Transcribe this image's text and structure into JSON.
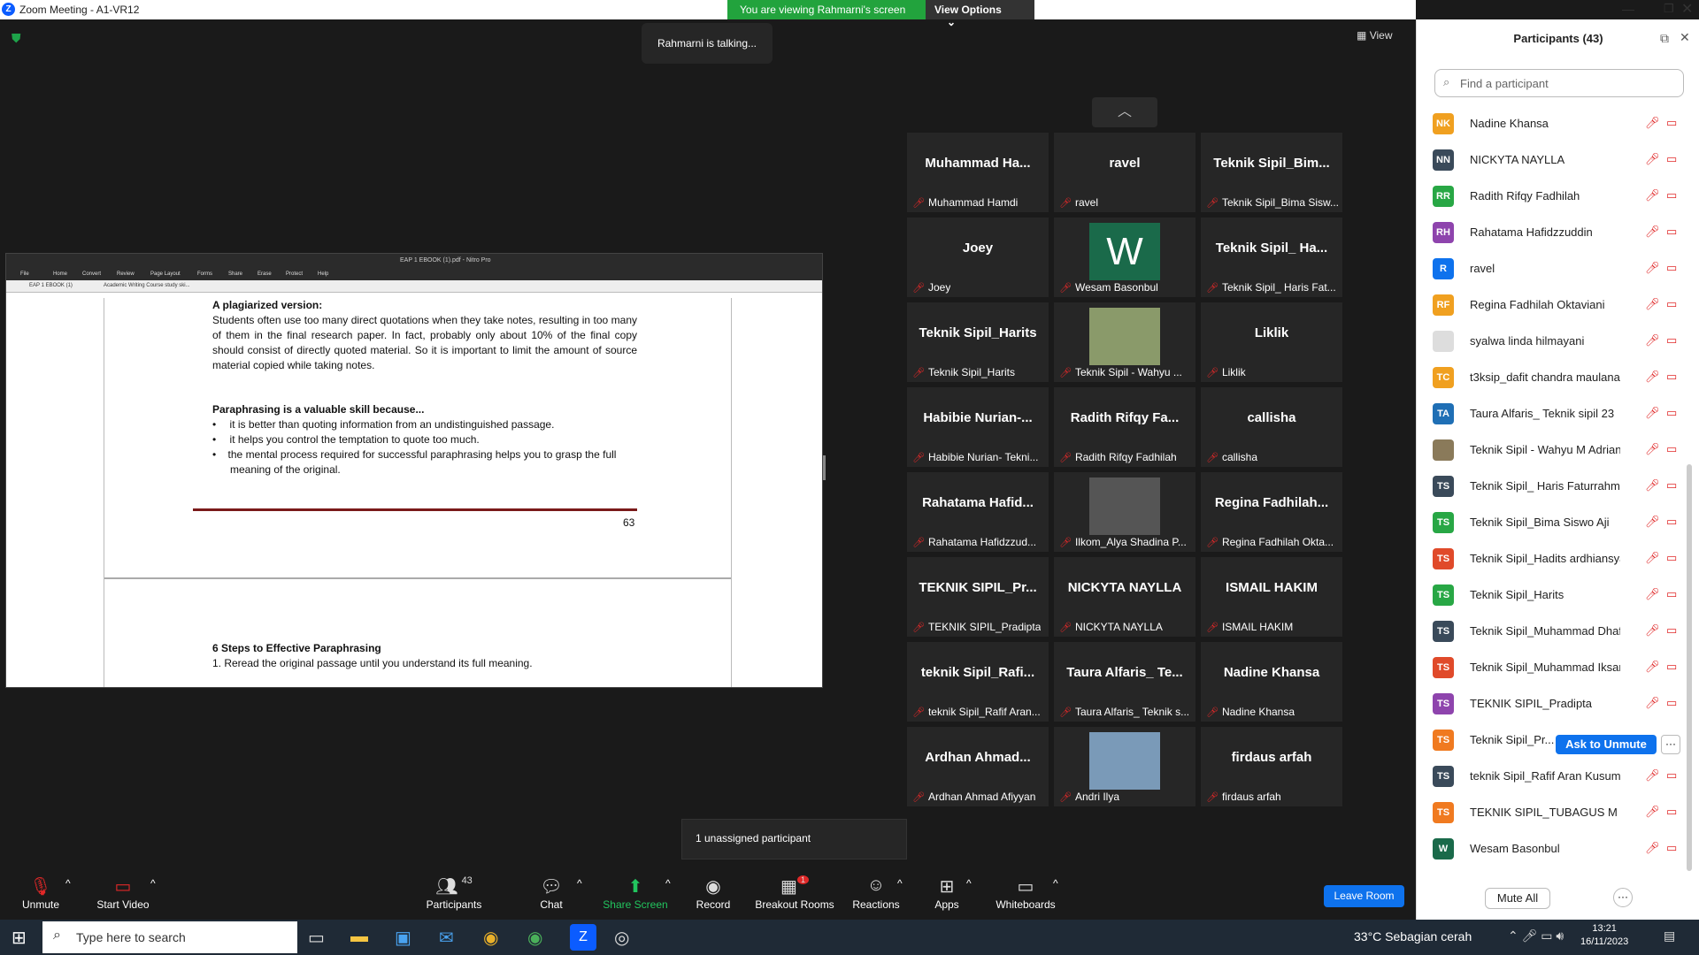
{
  "window": {
    "title": "Zoom Meeting - A1-VR12",
    "logo": "Z"
  },
  "banner": {
    "viewing": "You are viewing Rahmarni's screen",
    "view_options": "View Options"
  },
  "talking": "Rahmarni is talking...",
  "view_button": "View",
  "shared_screen": {
    "app_title": "EAP 1 EBOOK (1).pdf - Nitro Pro",
    "menu": [
      "File",
      "Home",
      "Convert",
      "Review",
      "Page Layout",
      "Forms",
      "Share",
      "Erase",
      "Protect",
      "Help"
    ],
    "tabs": [
      "EAP 1 EBOOK (1)",
      "Academic Writing Course study ski..."
    ],
    "heading1": "A plagiarized version:",
    "para1": "Students often use too many direct quotations when they take notes, resulting in too many of them in the final research paper. In fact, probably only about 10% of the final copy should consist of directly quoted material. So it is important to limit the amount of source material copied while taking notes.",
    "heading2": "Paraphrasing is a valuable skill because...",
    "bullets": [
      "it is better than quoting information from an undistinguished passage.",
      "it helps you control the temptation to quote too much.",
      "the mental process required for successful paraphrasing helps you to grasp the full meaning of the original."
    ],
    "page_number": "63",
    "heading3": "6 Steps to Effective Paraphrasing",
    "step1": "1.   Reread the original passage until you understand its full meaning."
  },
  "tiles": [
    {
      "big": "Muhammad  Ha...",
      "small": "Muhammad Hamdi"
    },
    {
      "big": "ravel",
      "small": "ravel"
    },
    {
      "big": "Teknik  Sipil_Bim...",
      "small": "Teknik Sipil_Bima Sisw..."
    },
    {
      "big": "Joey",
      "small": "Joey"
    },
    {
      "big": "W",
      "small": "Wesam Basonbul",
      "avatar": true
    },
    {
      "big": "Teknik  Sipil_  Ha...",
      "small": "Teknik Sipil_ Haris Fat..."
    },
    {
      "big": "Teknik Sipil_Harits",
      "small": "Teknik Sipil_Harits"
    },
    {
      "big": "",
      "small": "Teknik Sipil - Wahyu ...",
      "photo": "#8a9a6a"
    },
    {
      "big": "Liklik",
      "small": "Liklik"
    },
    {
      "big": "Habibie  Nurian-...",
      "small": "Habibie Nurian- Tekni..."
    },
    {
      "big": "Radith  Rifqy  Fa...",
      "small": "Radith Rifqy Fadhilah"
    },
    {
      "big": "callisha",
      "small": "callisha"
    },
    {
      "big": "Rahatama  Hafid...",
      "small": "Rahatama Hafidzzud..."
    },
    {
      "big": "",
      "small": "Ilkom_Alya Shadina P...",
      "photo": "#555"
    },
    {
      "big": "Regina  Fadhilah...",
      "small": "Regina Fadhilah Okta..."
    },
    {
      "big": "TEKNIK  SIPIL_Pr...",
      "small": "TEKNIK SIPIL_Pradipta"
    },
    {
      "big": "NICKYTA  NAYLLA",
      "small": "NICKYTA NAYLLA"
    },
    {
      "big": "ISMAIL  HAKIM",
      "small": "ISMAIL HAKIM"
    },
    {
      "big": "teknik  Sipil_Rafi...",
      "small": "teknik Sipil_Rafif Aran..."
    },
    {
      "big": "Taura  Alfaris_  Te...",
      "small": "Taura Alfaris_ Teknik s..."
    },
    {
      "big": "Nadine  Khansa",
      "small": "Nadine Khansa"
    },
    {
      "big": "Ardhan  Ahmad...",
      "small": "Ardhan Ahmad Afiyyan"
    },
    {
      "big": "",
      "small": "Andri Ilya",
      "photo": "#7a9ab8"
    },
    {
      "big": "firdaus  arfah",
      "small": "firdaus arfah"
    }
  ],
  "unassigned": "1 unassigned participant",
  "toolbar": {
    "unmute": "Unmute",
    "start_video": "Start Video",
    "participants": "Participants",
    "participants_count": "43",
    "chat": "Chat",
    "share_screen": "Share Screen",
    "record": "Record",
    "breakout_rooms": "Breakout Rooms",
    "breakout_badge": "1",
    "reactions": "Reactions",
    "apps": "Apps",
    "whiteboards": "Whiteboards",
    "leave": "Leave Room"
  },
  "panel": {
    "title": "Participants (43)",
    "search_placeholder": "Find a participant",
    "participants": [
      {
        "initials": "NK",
        "name": "Nadine Khansa",
        "color": "#f0a020"
      },
      {
        "initials": "NN",
        "name": "NICKYTA NAYLLA",
        "color": "#3a4a5a"
      },
      {
        "initials": "RR",
        "name": "Radith Rifqy Fadhilah",
        "color": "#28a745"
      },
      {
        "initials": "RH",
        "name": "Rahatama Hafidzzuddin",
        "color": "#8e44ad"
      },
      {
        "initials": "R",
        "name": "ravel",
        "color": "#0e72ed"
      },
      {
        "initials": "RF",
        "name": "Regina Fadhilah Oktaviani",
        "color": "#f0a020"
      },
      {
        "initials": "",
        "name": "syalwa linda hilmayani",
        "color": "#ddd"
      },
      {
        "initials": "TC",
        "name": "t3ksip_dafit chandra maulana",
        "color": "#f0a020"
      },
      {
        "initials": "TA",
        "name": "Taura Alfaris_ Teknik sipil 23",
        "color": "#1f6fb5"
      },
      {
        "initials": "",
        "name": "Teknik Sipil - Wahyu M Adrians...",
        "color": "#8a7a5a"
      },
      {
        "initials": "TS",
        "name": "Teknik Sipil_ Haris Faturrahman...",
        "color": "#3a4a5a"
      },
      {
        "initials": "TS",
        "name": "Teknik Sipil_Bima Siswo Aji",
        "color": "#28a745"
      },
      {
        "initials": "TS",
        "name": "Teknik Sipil_Hadits ardhiansyah",
        "color": "#e04a2a"
      },
      {
        "initials": "TS",
        "name": "Teknik Sipil_Harits",
        "color": "#28a745"
      },
      {
        "initials": "TS",
        "name": "Teknik Sipil_Muhammad Dhafa ...",
        "color": "#3a4a5a"
      },
      {
        "initials": "TS",
        "name": "Teknik Sipil_Muhammad Iksan ...",
        "color": "#e04a2a"
      },
      {
        "initials": "TS",
        "name": "TEKNIK SIPIL_Pradipta",
        "color": "#8e44ad"
      },
      {
        "initials": "TS",
        "name": "Teknik Sipil_Pr...",
        "color": "#f07a20"
      },
      {
        "initials": "TS",
        "name": "teknik Sipil_Rafif Aran Kusumo",
        "color": "#3a4a5a"
      },
      {
        "initials": "TS",
        "name": "TEKNIK SIPIL_TUBAGUS M YUS...",
        "color": "#f07a20"
      },
      {
        "initials": "W",
        "name": "Wesam Basonbul",
        "color": "#1a6a4a"
      }
    ],
    "ask_to_unmute": "Ask to Unmute",
    "mute_all": "Mute All"
  },
  "taskbar": {
    "search": "Type here to search",
    "weather": "33°C  Sebagian cerah",
    "time": "13:21",
    "date": "16/11/2023"
  }
}
